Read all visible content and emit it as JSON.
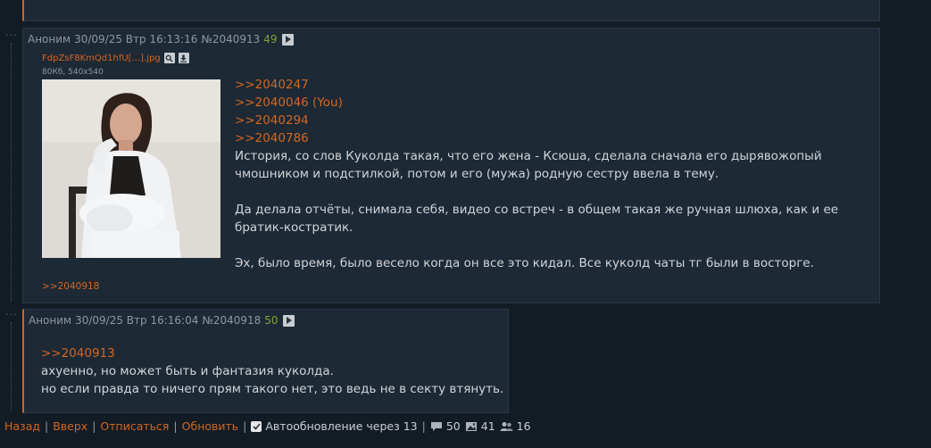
{
  "posts": [
    {
      "author": "Аноним",
      "date": "30/09/25 Втр 16:13:16",
      "number": "№2040913",
      "reply_count": "49",
      "file": {
        "name": "FdpZsF8KmQd1hfU[...].jpg",
        "info": "80Кб, 540x540"
      },
      "reply_links": [
        ">>2040247",
        ">>2040046 (You)",
        ">>2040294",
        ">>2040786"
      ],
      "body": [
        "История, со слов Куколда такая, что его жена - Ксюша, сделала сначала его дырявожопый чмошником и подстилкой, потом и его (мужа) родную сестру ввела в тему.",
        "Да делала отчёты, снимала себя, видео со встреч - в общем такая же ручная шлюха, как и ее братик-костратик.",
        "Эх, было время, было весело когда он все это кидал. Все куколд чаты тг были в восторге."
      ],
      "backlink": ">>2040918"
    },
    {
      "author": "Аноним",
      "date": "30/09/25 Втр 16:16:04",
      "number": "№2040918",
      "reply_count": "50",
      "reply_link": ">>2040913",
      "body": [
        "ахуенно, но может быть и фантазия куколда.",
        "но если правда то ничего прям такого нет, это ведь не в секту втянуть."
      ]
    }
  ],
  "bottom_bar": {
    "back": "Назад",
    "top": "Вверх",
    "unsubscribe": "Отписаться",
    "refresh": "Обновить",
    "autorefresh_label": "Автообновление через 13",
    "autorefresh_checked": true,
    "posts_count": "50",
    "images_count": "41",
    "users_count": "16"
  },
  "icons": {
    "play": "play-icon",
    "search": "search-icon",
    "download": "download-icon",
    "comment": "comment-icon",
    "image": "image-icon",
    "users": "users-icon"
  },
  "colors": {
    "background": "#131c25",
    "post_background": "#1d2935",
    "accent": "#d46620",
    "reply_count": "#7fa33a",
    "meta_text": "#8f979e"
  }
}
